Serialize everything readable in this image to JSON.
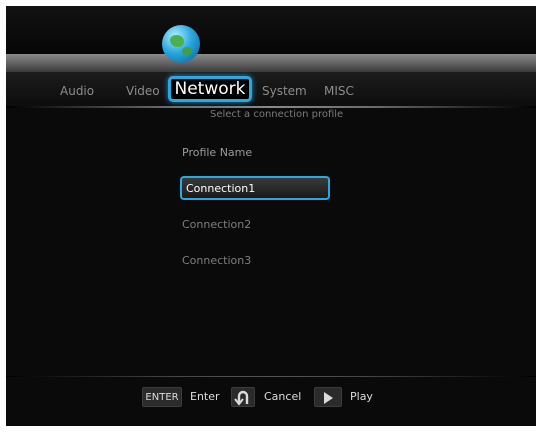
{
  "tabs": [
    {
      "label": "Audio"
    },
    {
      "label": "Video"
    },
    {
      "label": "Network",
      "active": true
    },
    {
      "label": "System"
    },
    {
      "label": "MISC"
    }
  ],
  "subtitle": "Select a connection profile",
  "profiles": {
    "header": "Profile Name",
    "items": [
      "Connection1",
      "Connection2",
      "Connection3"
    ],
    "selected_index": 0
  },
  "footer": {
    "enter_key": "ENTER",
    "enter_label": "Enter",
    "cancel_icon": "return-arrow-icon",
    "cancel_label": "Cancel",
    "play_icon": "play-icon",
    "play_label": "Play"
  },
  "colors": {
    "accent": "#2aa8e0",
    "background": "#0a0a0a"
  }
}
